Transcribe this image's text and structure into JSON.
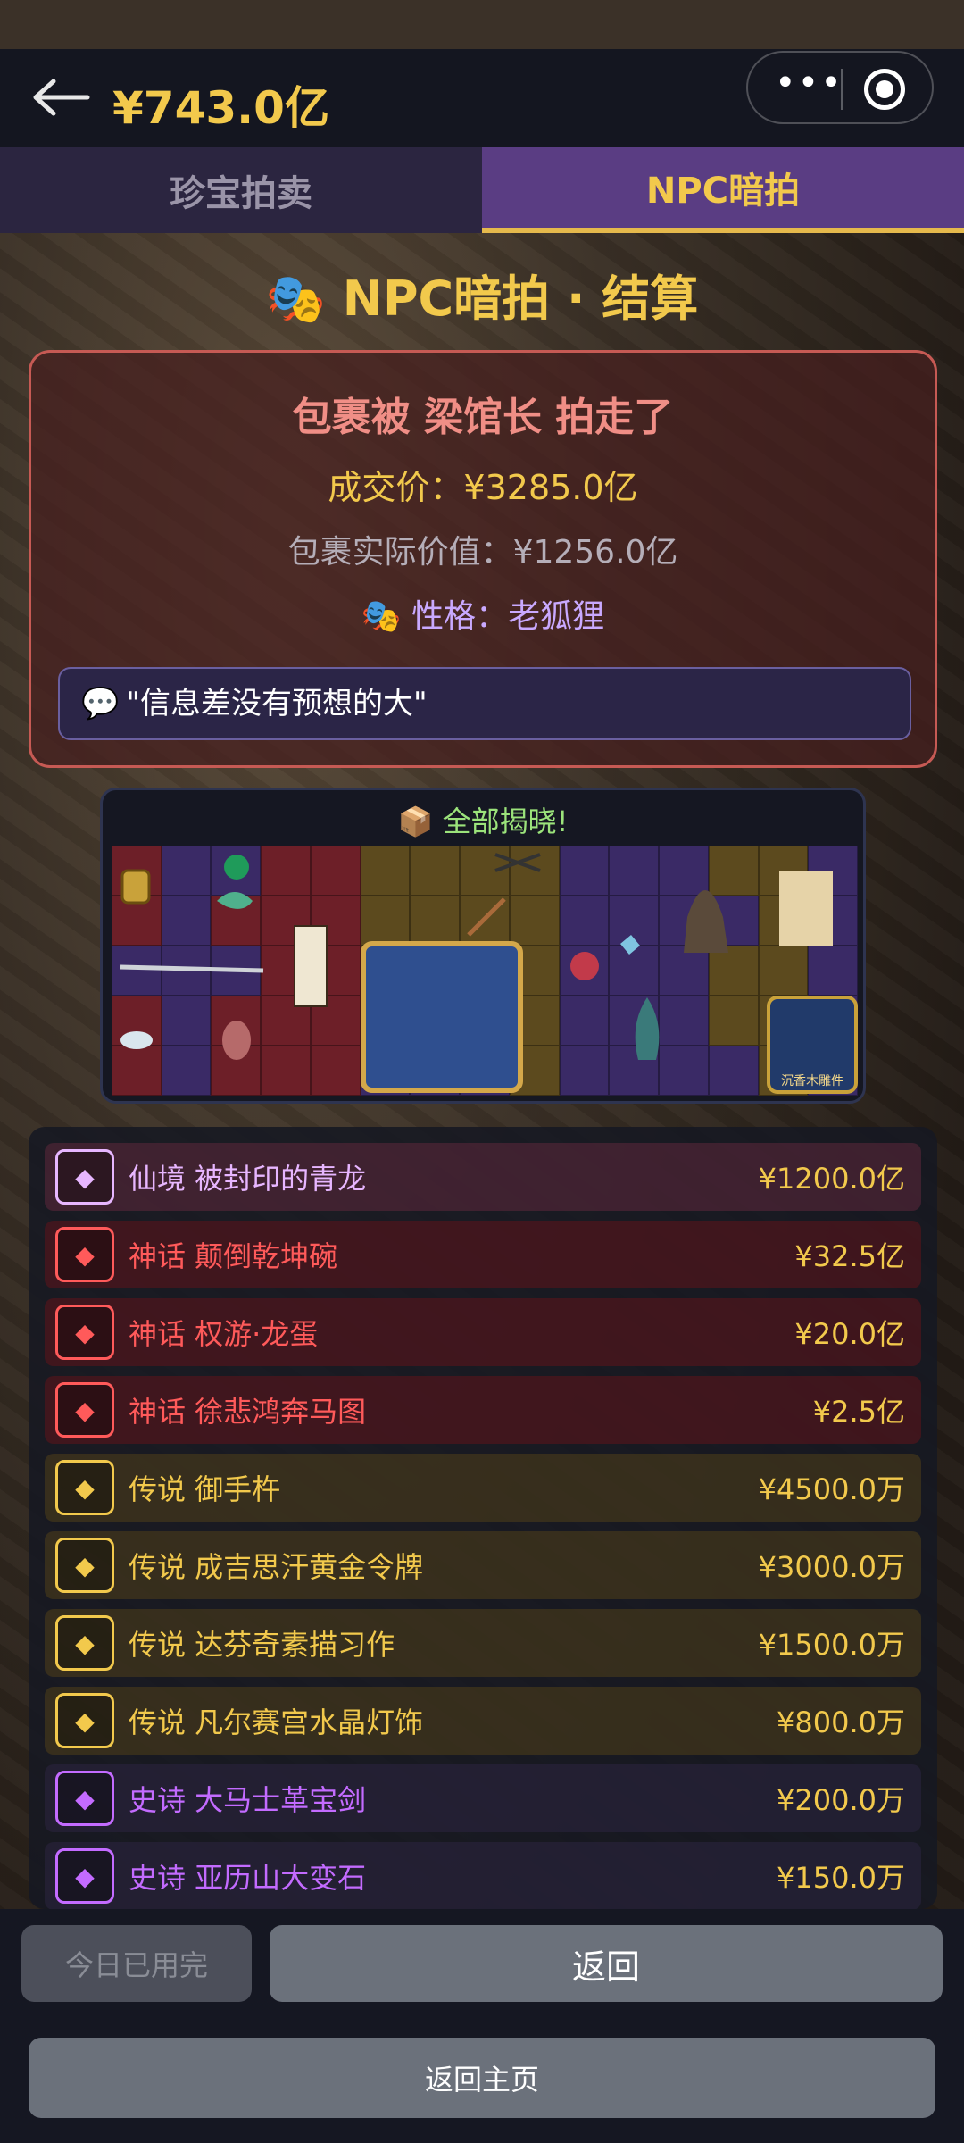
{
  "header": {
    "balance": "¥743.0亿"
  },
  "tabs": [
    {
      "label": "珍宝拍卖"
    },
    {
      "label": "NPC暗拍"
    }
  ],
  "page_title": "NPC暗拍 · 结算",
  "result": {
    "headline": "包裹被 梁馆长 拍走了",
    "deal_price": "成交价：¥3285.0亿",
    "actual_value": "包裹实际价值：¥1256.0亿",
    "personality": "性格：老狐狸",
    "quote": "\"信息差没有预想的大\""
  },
  "reveal": {
    "title": "全部揭晓!",
    "badge": "沉香木雕件"
  },
  "items": [
    {
      "tier": "仙境",
      "name": "被封印的青龙",
      "price": "¥1200.0亿",
      "color": "#e7b6ff"
    },
    {
      "tier": "神话",
      "name": "颠倒乾坤碗",
      "price": "¥32.5亿",
      "color": "#ff5a5a"
    },
    {
      "tier": "神话",
      "name": "权游·龙蛋",
      "price": "¥20.0亿",
      "color": "#ff5a5a"
    },
    {
      "tier": "神话",
      "name": "徐悲鸿奔马图",
      "price": "¥2.5亿",
      "color": "#ff5a5a"
    },
    {
      "tier": "传说",
      "name": "御手杵",
      "price": "¥4500.0万",
      "color": "#f2c94c"
    },
    {
      "tier": "传说",
      "name": "成吉思汗黄金令牌",
      "price": "¥3000.0万",
      "color": "#f2c94c"
    },
    {
      "tier": "传说",
      "name": "达芬奇素描习作",
      "price": "¥1500.0万",
      "color": "#f2c94c"
    },
    {
      "tier": "传说",
      "name": "凡尔赛宫水晶灯饰",
      "price": "¥800.0万",
      "color": "#f2c94c"
    },
    {
      "tier": "史诗",
      "name": "大马士革宝剑",
      "price": "¥200.0万",
      "color": "#c36bff"
    },
    {
      "tier": "史诗",
      "name": "亚历山大变石",
      "price": "¥150.0万",
      "color": "#c36bff"
    }
  ],
  "buttons": {
    "used": "今日已用完",
    "back": "返回",
    "home": "返回主页"
  }
}
